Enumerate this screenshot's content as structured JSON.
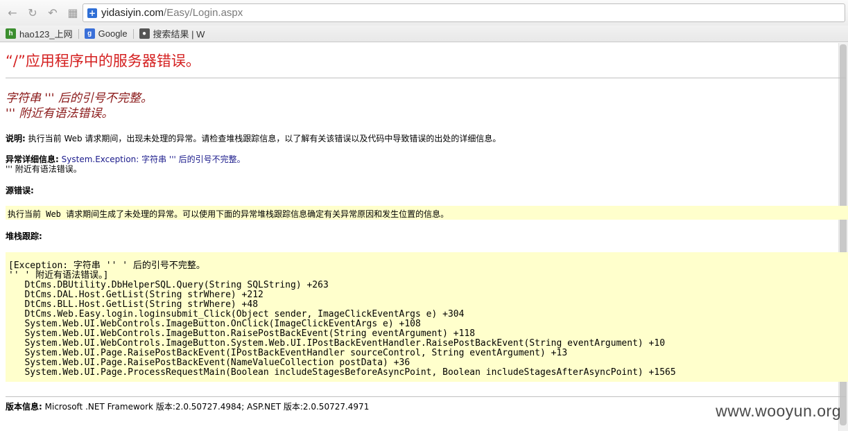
{
  "browser": {
    "url_host": "yidasiyin.com",
    "url_path": "/Easy/Login.aspx",
    "bookmarks": [
      {
        "label": "hao123_上网",
        "icon": "hao123-icon",
        "color": "#3b8e2e"
      },
      {
        "label": "Google",
        "icon": "google-icon",
        "color": "#3a6fd8"
      },
      {
        "label": "搜索结果 | W",
        "icon": "search-result-icon",
        "color": "#555555"
      }
    ]
  },
  "page": {
    "title": "“/”应用程序中的服务器错误。",
    "error_heading_line1": "字符串 ''' 后的引号不完整。",
    "error_heading_line2": "''' 附近有语法错误。",
    "description_label": "说明:",
    "description_text": "执行当前 Web 请求期间，出现未处理的异常。请检查堆栈跟踪信息，以了解有关该错误以及代码中导致错误的出处的详细信息。",
    "exception_label": "异常详细信息:",
    "exception_text": "System.Exception: 字符串 ''' 后的引号不完整。",
    "exception_text_line2": "''' 附近有语法错误。",
    "source_label": "源错误:",
    "source_text": "执行当前 Web 请求期间生成了未处理的异常。可以使用下面的异常堆栈跟踪信息确定有关异常原因和发生位置的信息。",
    "stack_label": "堆栈跟踪:",
    "stack_lines": [
      "[Exception: 字符串 '' ' 后的引号不完整。",
      "'' ' 附近有语法错误。]",
      "   DtCms.DBUtility.DbHelperSQL.Query(String SQLString) +263",
      "   DtCms.DAL.Host.GetList(String strWhere) +212",
      "   DtCms.BLL.Host.GetList(String strWhere) +48",
      "   DtCms.Web.Easy.login.loginsubmit_Click(Object sender, ImageClickEventArgs e) +304",
      "   System.Web.UI.WebControls.ImageButton.OnClick(ImageClickEventArgs e) +108",
      "   System.Web.UI.WebControls.ImageButton.RaisePostBackEvent(String eventArgument) +118",
      "   System.Web.UI.WebControls.ImageButton.System.Web.UI.IPostBackEventHandler.RaisePostBackEvent(String eventArgument) +10",
      "   System.Web.UI.Page.RaisePostBackEvent(IPostBackEventHandler sourceControl, String eventArgument) +13",
      "   System.Web.UI.Page.RaisePostBackEvent(NameValueCollection postData) +36",
      "   System.Web.UI.Page.ProcessRequestMain(Boolean includeStagesBeforeAsyncPoint, Boolean includeStagesAfterAsyncPoint) +1565"
    ],
    "version_label": "版本信息:",
    "version_text": "Microsoft .NET Framework 版本:2.0.50727.4984; ASP.NET 版本:2.0.50727.4971"
  },
  "watermark": "www.wooyun.org",
  "colors": {
    "title_red": "#d42020",
    "heading_maroon": "#8b1a1a",
    "box_yellow": "#ffffcc"
  }
}
